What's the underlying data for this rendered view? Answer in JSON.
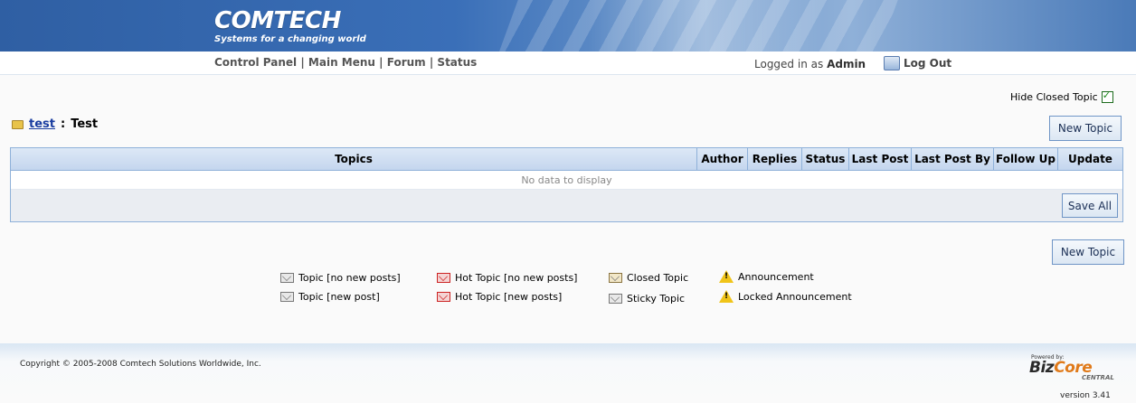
{
  "brand": {
    "logo": "COMTECH",
    "tagline": "Systems for a changing world"
  },
  "nav": {
    "control_panel": "Control Panel",
    "main_menu": "Main Menu",
    "forum": "Forum",
    "status": "Status",
    "sep": "|"
  },
  "user": {
    "logged_in_prefix": "Logged in as",
    "name": "Admin",
    "logout": "Log Out"
  },
  "filters": {
    "hide_closed_label": "Hide Closed Topic",
    "hide_closed_checked": true
  },
  "breadcrumb": {
    "link": "test",
    "sep": ":",
    "current": "Test"
  },
  "buttons": {
    "new_topic": "New Topic",
    "save_all": "Save All"
  },
  "grid": {
    "columns": [
      "Topics",
      "Author",
      "Replies",
      "Status",
      "Last Post",
      "Last Post By",
      "Follow Up",
      "Update"
    ],
    "empty_text": "No data to display"
  },
  "legend": {
    "topic_no_new": "Topic [no new posts]",
    "topic_new": "Topic [new post]",
    "hot_no_new": "Hot Topic [no new posts]",
    "hot_new": "Hot Topic [new posts]",
    "closed": "Closed Topic",
    "sticky": "Sticky Topic",
    "announcement": "Announcement",
    "locked_announcement": "Locked Announcement"
  },
  "footer": {
    "copyright": "Copyright © 2005-2008 Comtech Solutions Worldwide, Inc.",
    "powered_by": "Powered by:",
    "biz": "Biz",
    "core": "Core",
    "central": "CENTRAL",
    "version": "version 3.41"
  }
}
